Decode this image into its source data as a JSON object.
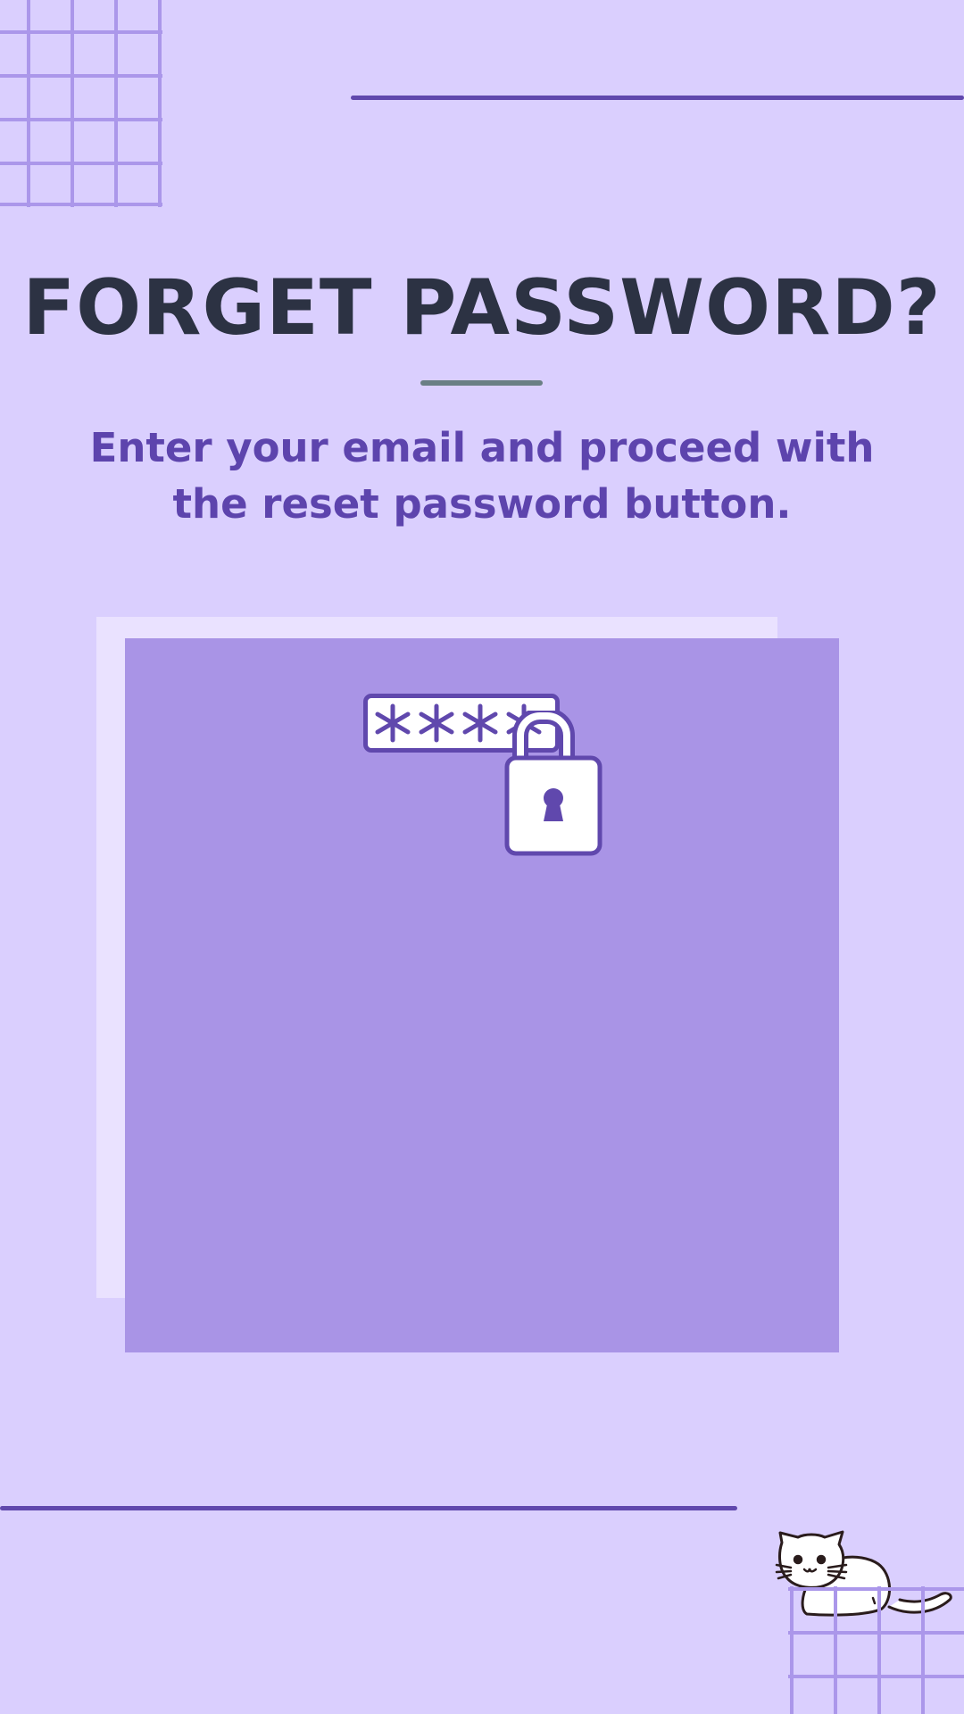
{
  "page": {
    "title": "FORGET PASSWORD?",
    "subtitle_line1": "Enter your email and proceed with",
    "subtitle_line2": "the reset password button."
  },
  "illustration": {
    "password_mask": "****",
    "icons": [
      "password-field-icon",
      "padlock-icon",
      "keyhole-icon",
      "cat-illustration"
    ]
  },
  "colors": {
    "background": "#dacffe",
    "accent": "#6048ad",
    "title": "#2c3243",
    "panel": "#a994e6",
    "panel_back": "#eae2ff",
    "divider": "#6a7f84"
  }
}
